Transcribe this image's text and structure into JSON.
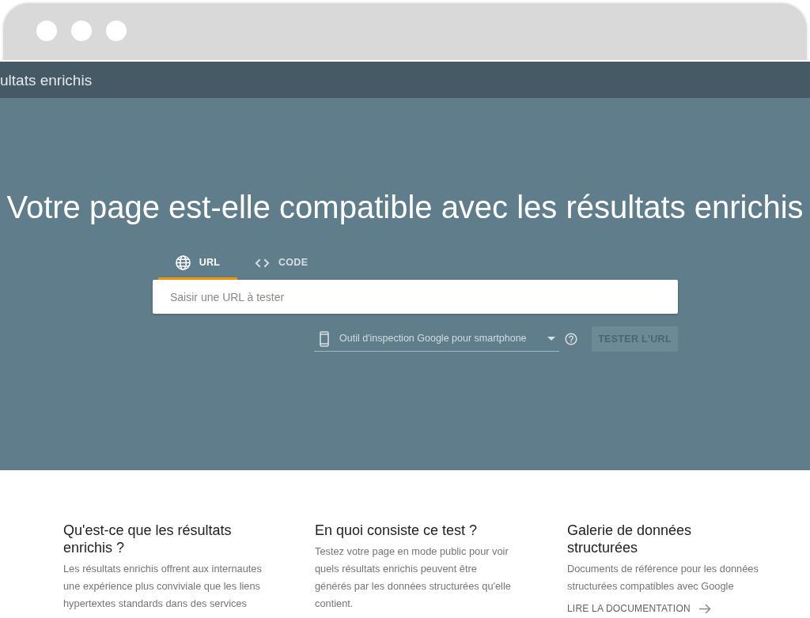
{
  "page_header": {
    "title": "ultats enrichis"
  },
  "hero": {
    "title": "Votre page est-elle compatible avec les résultats enrichis",
    "tabs": [
      {
        "kind": "url",
        "label": "URL",
        "selected": true
      },
      {
        "kind": "code",
        "label": "CODE",
        "selected": false
      }
    ],
    "url_field": {
      "placeholder": "Saisir une URL à tester"
    },
    "device_select": {
      "value": "Outil d'inspection Google pour smartphone"
    },
    "test_button": {
      "label": "TESTER L'URL",
      "disabled": true
    }
  },
  "info_columns": [
    {
      "title": "Qu'est-ce que les résultats enrichis ?",
      "text": "Les résultats enrichis offrent aux internautes une expérience plus conviviale que les liens hypertextes standards dans des services"
    },
    {
      "title": "En quoi consiste ce test ?",
      "text": "Testez votre page en mode public pour voir quels résultats enrichis peuvent être générés par les données structurées qu'elle contient."
    },
    {
      "title": "Galerie de données structurées",
      "text": "Documents de référence pour les données structurées compatibles avec Google",
      "link": "LIRE LA DOCUMENTATION"
    }
  ]
}
